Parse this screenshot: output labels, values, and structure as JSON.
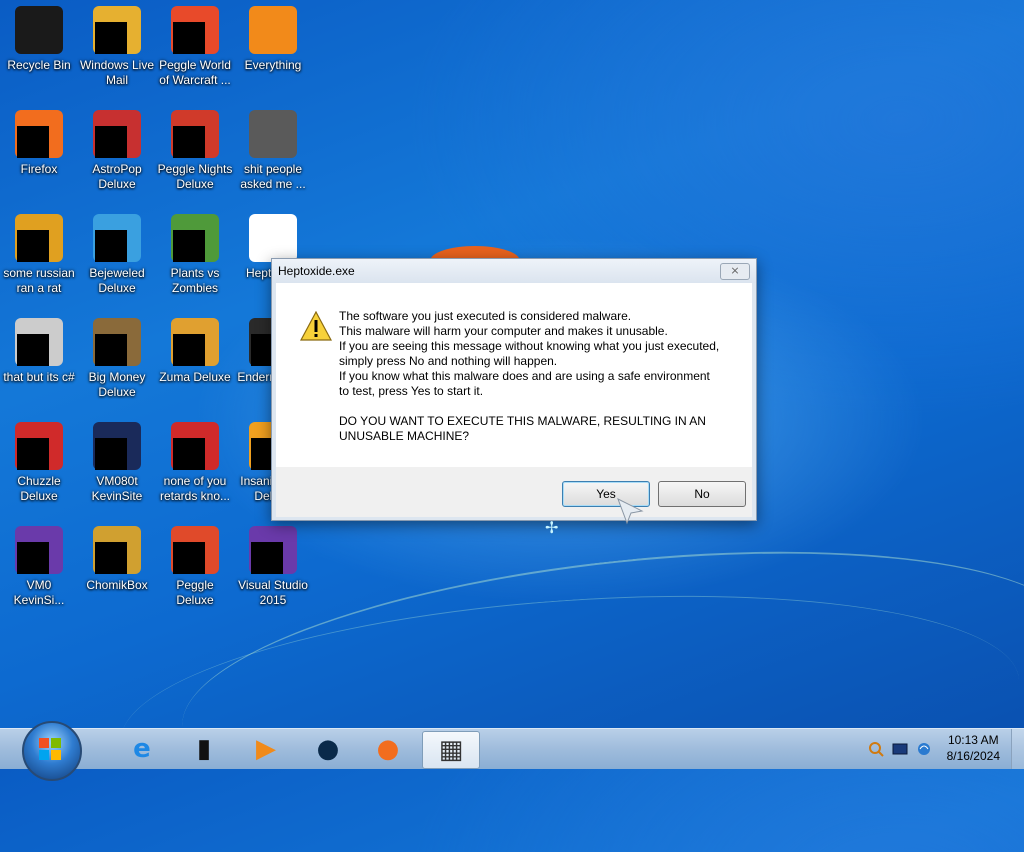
{
  "desktop": {
    "icons": [
      {
        "label": "Recycle Bin",
        "icon": "recycle-bin-icon",
        "color": "#1a1a1a"
      },
      {
        "label": "Windows Live\nMail",
        "icon": "mail-icon",
        "color": "#e6b030"
      },
      {
        "label": "Peggle World\nof Warcraft ...",
        "icon": "peggle-icon",
        "color": "#e84a2a"
      },
      {
        "label": "Everything",
        "icon": "everything-icon",
        "color": "#f28a1a"
      },
      {
        "label": "Firefox",
        "icon": "firefox-icon",
        "color": "#f26d1e"
      },
      {
        "label": "AstroPop\nDeluxe",
        "icon": "astropop-icon",
        "color": "#c73030"
      },
      {
        "label": "Peggle Nights\nDeluxe",
        "icon": "peggle-nights-icon",
        "color": "#d03a2a"
      },
      {
        "label": "shit people\nasked me ...",
        "icon": "folder-icon",
        "color": "#5a5a5a"
      },
      {
        "label": "some russian\nran a rat",
        "icon": "app-icon",
        "color": "#e0a020"
      },
      {
        "label": "Bejeweled\nDeluxe",
        "icon": "bejeweled-icon",
        "color": "#3aa0e0"
      },
      {
        "label": "Plants vs\nZombies",
        "icon": "pvz-icon",
        "color": "#4f9a3a"
      },
      {
        "label": "Heptoxide",
        "icon": "exe-file-icon",
        "color": "#ffffff"
      },
      {
        "label": "that but its c#",
        "icon": "stack-icon",
        "color": "#cccccc"
      },
      {
        "label": "Big Money\nDeluxe",
        "icon": "big-money-icon",
        "color": "#8a6a3a"
      },
      {
        "label": "Zuma Deluxe",
        "icon": "zuma-icon",
        "color": "#e0a030"
      },
      {
        "label": "Endermanc...",
        "icon": "terminal-icon",
        "color": "#2a2a2a"
      },
      {
        "label": "Chuzzle\nDeluxe",
        "icon": "chuzzle-icon",
        "color": "#d02a2a"
      },
      {
        "label": "VM080t\nKevinSite",
        "icon": "monitor-icon",
        "color": "#1a2a5a"
      },
      {
        "label": "none of you\nretards kno...",
        "icon": "chrome-like-icon",
        "color": "#d02a2a"
      },
      {
        "label": "Insaniquar...\nDeluxe",
        "icon": "fish-icon",
        "color": "#f0a020"
      },
      {
        "label": "VM0\nKevinSi...",
        "icon": "vm-icon",
        "color": "#6a3aaa"
      },
      {
        "label": "ChomikBox",
        "icon": "chomikbox-icon",
        "color": "#d0a030"
      },
      {
        "label": "Peggle Deluxe",
        "icon": "peggle-deluxe-icon",
        "color": "#e04a2a"
      },
      {
        "label": "Visual Studio\n2015",
        "icon": "visual-studio-icon",
        "color": "#6a3aaa"
      }
    ]
  },
  "dialog": {
    "title": "Heptoxide.exe",
    "close_label": "⨯",
    "message_para1": "The software you just executed is considered malware.\nThis malware will harm your computer and makes it unusable.\nIf you are seeing this message without knowing what you just executed,\nsimply press No and nothing will happen.\nIf you know what this malware does and are using a safe environment\nto test, press Yes to start it.",
    "message_para2": "DO YOU WANT TO EXECUTE THIS MALWARE, RESULTING IN AN\nUNUSABLE MACHINE?",
    "yes_label": "Yes",
    "no_label": "No",
    "icon": "warning-icon"
  },
  "taskbar": {
    "start": "windows-start-orb",
    "pinned": [
      {
        "icon": "internet-explorer-icon",
        "active": false
      },
      {
        "icon": "terminal-icon",
        "active": false
      },
      {
        "icon": "media-player-icon",
        "active": false
      },
      {
        "icon": "globe-icon",
        "active": false
      },
      {
        "icon": "firefox-icon",
        "active": false
      },
      {
        "icon": "heptoxide-icon",
        "active": true
      }
    ],
    "tray": [
      "search-tray-icon",
      "monitor-tray-icon",
      "network-tray-icon"
    ],
    "time": "10:13 AM",
    "date": "8/16/2024"
  }
}
